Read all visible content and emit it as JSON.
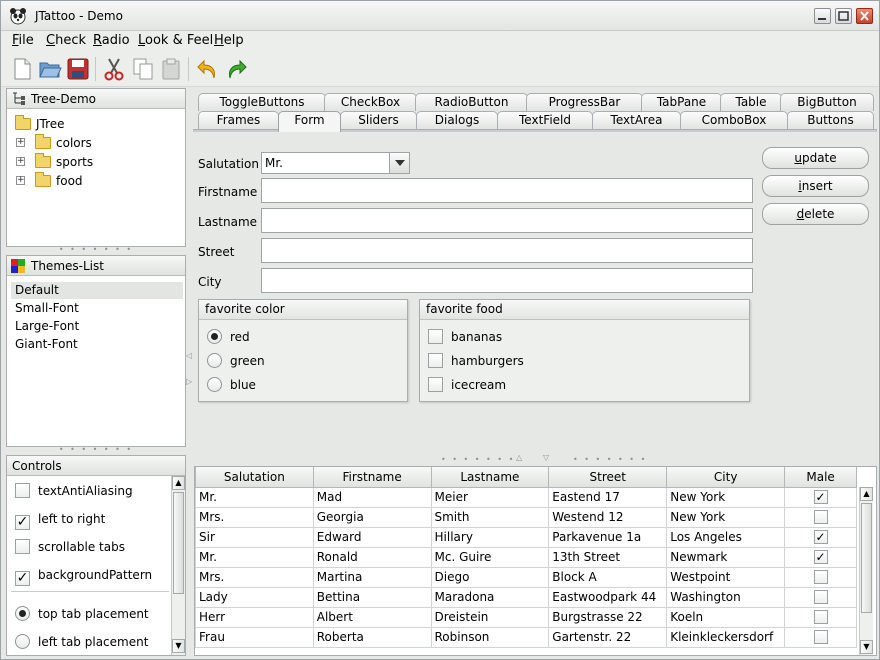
{
  "window": {
    "title": "JTattoo - Demo"
  },
  "menubar": [
    {
      "mnemonic": "F",
      "rest": "ile"
    },
    {
      "mnemonic": "C",
      "rest": "heck"
    },
    {
      "mnemonic": "R",
      "rest": "adio"
    },
    {
      "mnemonic": "L",
      "rest": "ook & Feel"
    },
    {
      "mnemonic": "H",
      "rest": "elp"
    }
  ],
  "toolbar_icons": [
    "new-file-icon",
    "open-folder-icon",
    "save-icon",
    "cut-icon",
    "copy-icon",
    "paste-icon",
    "undo-icon",
    "redo-icon"
  ],
  "tree_panel": {
    "title": "Tree-Demo",
    "root": "JTree",
    "items": [
      "colors",
      "sports",
      "food"
    ]
  },
  "themes_panel": {
    "title": "Themes-List",
    "items": [
      "Default",
      "Small-Font",
      "Large-Font",
      "Giant-Font"
    ],
    "selected": "Default"
  },
  "controls_panel": {
    "title": "Controls",
    "checkboxes": [
      {
        "label": "textAntiAliasing",
        "checked": false
      },
      {
        "label": "left to right",
        "checked": true
      },
      {
        "label": "scrollable tabs",
        "checked": false
      },
      {
        "label": "backgroundPattern",
        "checked": true
      }
    ],
    "radios": [
      {
        "label": "top tab placement",
        "selected": true
      },
      {
        "label": "left tab placement",
        "selected": false
      }
    ]
  },
  "tabs": {
    "row1": [
      "ToggleButtons",
      "CheckBox",
      "RadioButton",
      "ProgressBar",
      "TabPane",
      "Table",
      "BigButton"
    ],
    "row2": [
      "Frames",
      "Form",
      "Sliders",
      "Dialogs",
      "TextField",
      "TextArea",
      "ComboBox",
      "Buttons"
    ],
    "active": "Form"
  },
  "form": {
    "salutation_label": "Salutation",
    "salutation_value": "Mr.",
    "firstname_label": "Firstname",
    "lastname_label": "Lastname",
    "street_label": "Street",
    "city_label": "City",
    "buttons": [
      {
        "mnemonic": "u",
        "rest": "pdate"
      },
      {
        "mnemonic": "i",
        "rest": "nsert"
      },
      {
        "mnemonic": "d",
        "rest": "elete"
      }
    ],
    "color_group": {
      "title": "favorite color",
      "options": [
        "red",
        "green",
        "blue"
      ],
      "selected": "red"
    },
    "food_group": {
      "title": "favorite food",
      "options": [
        "bananas",
        "hamburgers",
        "icecream"
      ]
    }
  },
  "table": {
    "columns": [
      "Salutation",
      "Firstname",
      "Lastname",
      "Street",
      "City",
      "Male"
    ],
    "rows": [
      [
        "Mr.",
        "Mad",
        "Meier",
        "Eastend 17",
        "New York",
        true
      ],
      [
        "Mrs.",
        "Georgia",
        "Smith",
        "Westend 12",
        "New York",
        false
      ],
      [
        "Sir",
        "Edward",
        "Hillary",
        "Parkavenue 1a",
        "Los Angeles",
        true
      ],
      [
        "Mr.",
        "Ronald",
        "Mc. Guire",
        "13th Street",
        "Newmark",
        true
      ],
      [
        "Mrs.",
        "Martina",
        "Diego",
        "Block A",
        "Westpoint",
        false
      ],
      [
        "Lady",
        "Bettina",
        "Maradona",
        "Eastwoodpark 44",
        "Washington",
        false
      ],
      [
        "Herr",
        "Albert",
        "Dreistein",
        "Burgstrasse 22",
        "Koeln",
        false
      ],
      [
        "Frau",
        "Roberta",
        "Robinson",
        "Gartenstr. 22",
        "Kleinkleckersdorf",
        false
      ]
    ]
  }
}
